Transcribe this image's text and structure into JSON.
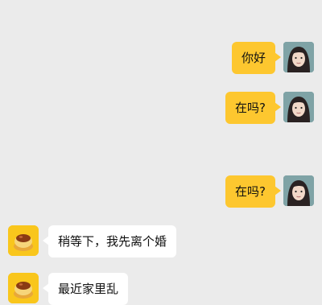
{
  "messages": [
    {
      "side": "right",
      "text": "你好",
      "avatar": "girl-avatar-icon"
    },
    {
      "side": "right",
      "text": "在吗?",
      "avatar": "girl-avatar-icon"
    },
    {
      "side": "right",
      "text": "在吗?",
      "avatar": "girl-avatar-icon"
    },
    {
      "side": "left",
      "text": "稍等下，我先离个婚",
      "avatar": "pudding-avatar-icon"
    },
    {
      "side": "left",
      "text": "最近家里乱",
      "avatar": "pudding-avatar-icon"
    }
  ],
  "colors": {
    "background": "#ebebeb",
    "outgoing_bubble": "#fdc72f",
    "incoming_bubble": "#ffffff",
    "pudding_avatar_bg": "#f9c61c"
  }
}
